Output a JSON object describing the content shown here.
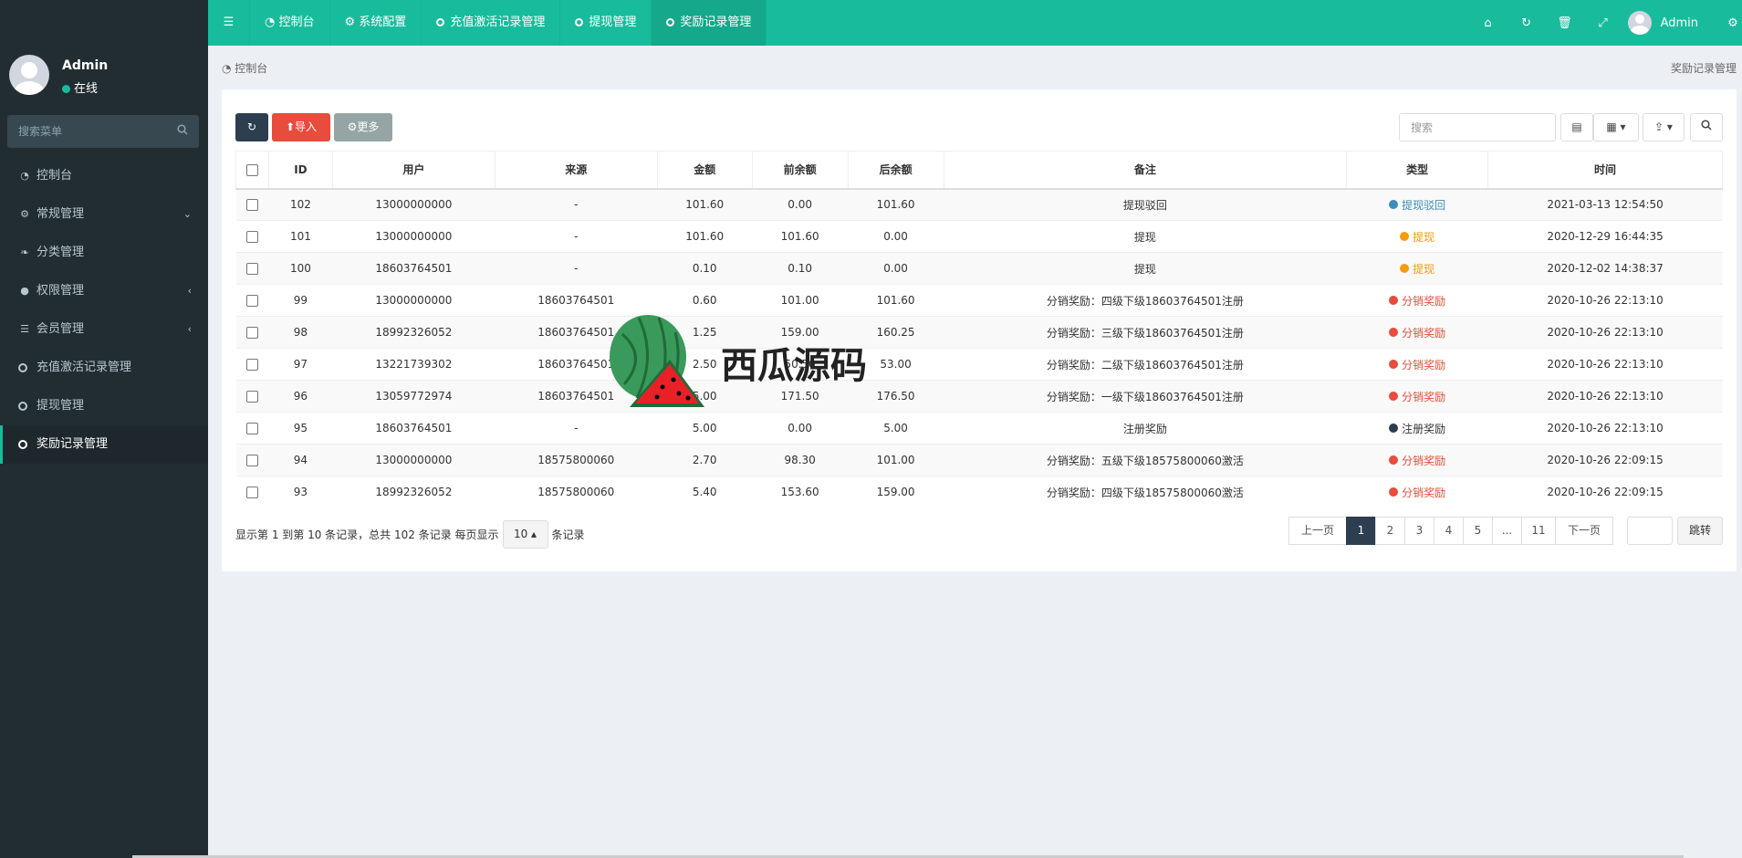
{
  "sidebar": {
    "user": {
      "name": "Admin",
      "status": "在线"
    },
    "search_placeholder": "搜索菜单",
    "items": [
      {
        "label": "控制台",
        "icon": "dashboard-icon"
      },
      {
        "label": "常规管理",
        "icon": "cogs-icon"
      },
      {
        "label": "分类管理",
        "icon": "leaf-icon"
      },
      {
        "label": "权限管理",
        "icon": "users-icon"
      },
      {
        "label": "会员管理",
        "icon": "list-icon"
      },
      {
        "label": "充值激活记录管理",
        "icon": "circle-icon"
      },
      {
        "label": "提现管理",
        "icon": "circle-icon"
      },
      {
        "label": "奖励记录管理",
        "icon": "circle-icon"
      }
    ]
  },
  "header": {
    "tabs": [
      {
        "label": "控制台"
      },
      {
        "label": "系统配置"
      },
      {
        "label": "充值激活记录管理"
      },
      {
        "label": "提现管理"
      },
      {
        "label": "奖励记录管理"
      }
    ],
    "user_name": "Admin"
  },
  "breadcrumb": {
    "left": "控制台",
    "right": "奖励记录管理"
  },
  "toolbar": {
    "import_label": "导入",
    "more_label": "更多",
    "search_placeholder": "搜索"
  },
  "table": {
    "columns": [
      "ID",
      "用户",
      "来源",
      "金额",
      "前余额",
      "后余额",
      "备注",
      "类型",
      "时间"
    ],
    "rows": [
      {
        "id": "102",
        "user": "13000000000",
        "source": "-",
        "amount": "101.60",
        "before": "0.00",
        "after": "101.60",
        "remark": "提现驳回",
        "type": "提现驳回",
        "type_color": "#3c8dbc",
        "time": "2021-03-13 12:54:50"
      },
      {
        "id": "101",
        "user": "13000000000",
        "source": "-",
        "amount": "101.60",
        "before": "101.60",
        "after": "0.00",
        "remark": "提现",
        "type": "提现",
        "type_color": "#f39c12",
        "time": "2020-12-29 16:44:35"
      },
      {
        "id": "100",
        "user": "18603764501",
        "source": "-",
        "amount": "0.10",
        "before": "0.10",
        "after": "0.00",
        "remark": "提现",
        "type": "提现",
        "type_color": "#f39c12",
        "time": "2020-12-02 14:38:37"
      },
      {
        "id": "99",
        "user": "13000000000",
        "source": "18603764501",
        "amount": "0.60",
        "before": "101.00",
        "after": "101.60",
        "remark": "分销奖励：四级下级18603764501注册",
        "type": "分销奖励",
        "type_color": "#e74c3c",
        "time": "2020-10-26 22:13:10"
      },
      {
        "id": "98",
        "user": "18992326052",
        "source": "18603764501",
        "amount": "1.25",
        "before": "159.00",
        "after": "160.25",
        "remark": "分销奖励：三级下级18603764501注册",
        "type": "分销奖励",
        "type_color": "#e74c3c",
        "time": "2020-10-26 22:13:10"
      },
      {
        "id": "97",
        "user": "13221739302",
        "source": "18603764501",
        "amount": "2.50",
        "before": "50.50",
        "after": "53.00",
        "remark": "分销奖励：二级下级18603764501注册",
        "type": "分销奖励",
        "type_color": "#e74c3c",
        "time": "2020-10-26 22:13:10"
      },
      {
        "id": "96",
        "user": "13059772974",
        "source": "18603764501",
        "amount": "5.00",
        "before": "171.50",
        "after": "176.50",
        "remark": "分销奖励：一级下级18603764501注册",
        "type": "分销奖励",
        "type_color": "#e74c3c",
        "time": "2020-10-26 22:13:10"
      },
      {
        "id": "95",
        "user": "18603764501",
        "source": "-",
        "amount": "5.00",
        "before": "0.00",
        "after": "5.00",
        "remark": "注册奖励",
        "type": "注册奖励",
        "type_color": "#2c3e50",
        "time": "2020-10-26 22:13:10"
      },
      {
        "id": "94",
        "user": "13000000000",
        "source": "18575800060",
        "amount": "2.70",
        "before": "98.30",
        "after": "101.00",
        "remark": "分销奖励：五级下级18575800060激活",
        "type": "分销奖励",
        "type_color": "#e74c3c",
        "time": "2020-10-26 22:09:15"
      },
      {
        "id": "93",
        "user": "18992326052",
        "source": "18575800060",
        "amount": "5.40",
        "before": "153.60",
        "after": "159.00",
        "remark": "分销奖励：四级下级18575800060激活",
        "type": "分销奖励",
        "type_color": "#e74c3c",
        "time": "2020-10-26 22:09:15"
      }
    ]
  },
  "pagination": {
    "info_prefix": "显示第 1 到第 10 条记录，总共 102 条记录 每页显示",
    "page_size": "10",
    "info_suffix": "条记录",
    "prev": "上一页",
    "pages": [
      "1",
      "2",
      "3",
      "4",
      "5",
      "...",
      "11"
    ],
    "current": "1",
    "next": "下一页",
    "jump_label": "跳转"
  },
  "watermark": {
    "text": "西瓜源码"
  },
  "colors": {
    "accent": "#18bc9c",
    "sidebar": "#222d32",
    "online": "#18bc9c"
  }
}
